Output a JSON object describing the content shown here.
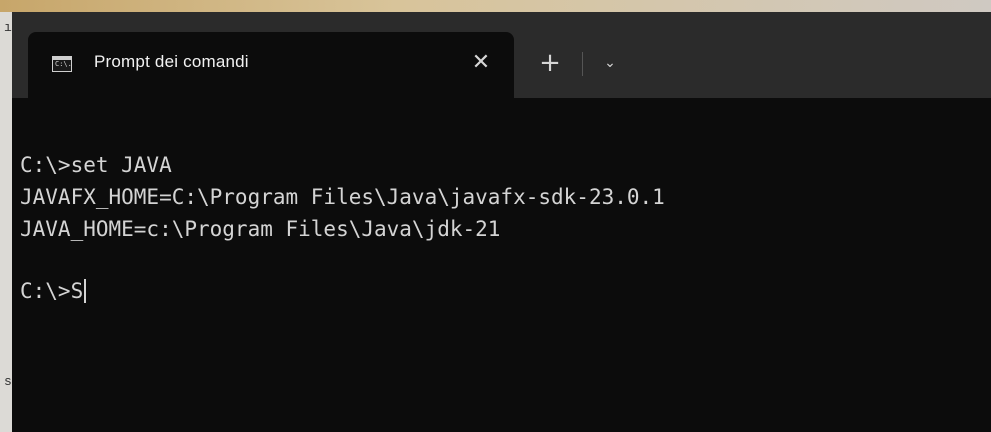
{
  "window": {
    "tab_title": "Prompt dei comandi",
    "tab_icon_text": "C:\\.",
    "close_glyph": "✕",
    "new_tab_glyph": "+",
    "dropdown_glyph": "⌄"
  },
  "terminal": {
    "lines": [
      "C:\\>set JAVA",
      "JAVAFX_HOME=C:\\Program Files\\Java\\javafx-sdk-23.0.1",
      "JAVA_HOME=c:\\Program Files\\Java\\jdk-21",
      "",
      "C:\\>S"
    ]
  },
  "background": {
    "edge_glyph_top": "ı",
    "edge_glyph_bottom": "s"
  },
  "colors": {
    "terminal_bg": "#0c0c0c",
    "titlebar_bg": "#2b2b2b",
    "text": "#d4d4d4"
  }
}
